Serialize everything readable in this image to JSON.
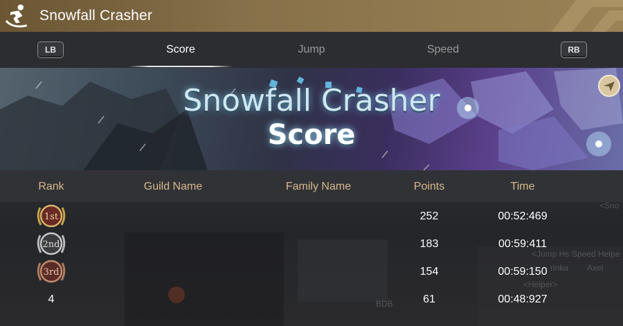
{
  "window": {
    "title": "Snowfall Crasher",
    "title_icon": "snowboarder-icon"
  },
  "tabs": {
    "lb_label": "LB",
    "rb_label": "RB",
    "items": [
      {
        "label": "Score",
        "active": true
      },
      {
        "label": "Jump",
        "active": false
      },
      {
        "label": "Speed",
        "active": false
      }
    ]
  },
  "banner": {
    "line1": "Snowfall Crasher",
    "line2": "Score",
    "corner_icon": "compass-icon"
  },
  "table": {
    "headers": {
      "rank": "Rank",
      "guild": "Guild Name",
      "family": "Family Name",
      "points": "Points",
      "time": "Time"
    },
    "rows": [
      {
        "rank": "1st",
        "medal": "gold-medal-icon",
        "guild": "",
        "family": "",
        "points": "252",
        "time": "00:52:469"
      },
      {
        "rank": "2nd",
        "medal": "silver-medal-icon",
        "guild": "",
        "family": "",
        "points": "183",
        "time": "00:59:411"
      },
      {
        "rank": "3rd",
        "medal": "bronze-medal-icon",
        "guild": "",
        "family": "",
        "points": "154",
        "time": "00:59:150"
      },
      {
        "rank": "4",
        "medal": "",
        "guild": "",
        "family": "",
        "points": "61",
        "time": "00:48:927"
      }
    ]
  },
  "background_labels": [
    "<Sno",
    "<Jump Hs",
    "Speed Helpe",
    "rinka",
    "Axel",
    "<Helper>",
    "BDB"
  ],
  "colors": {
    "header_text": "#d9b98c",
    "title_bar": "#87714a",
    "gold": "#c9a24a",
    "silver": "#b9b9b9",
    "bronze": "#b27a5c"
  }
}
